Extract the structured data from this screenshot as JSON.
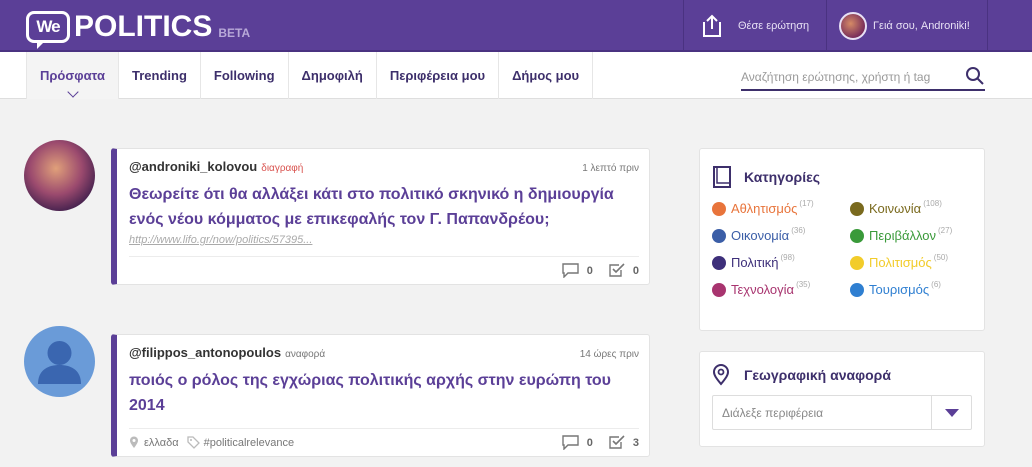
{
  "header": {
    "logo_we": "We",
    "logo_text": "POLITICS",
    "logo_beta": "BETA",
    "ask_label": "Θέσε ερώτηση",
    "greeting": "Γειά σου, Androniki!"
  },
  "nav": {
    "tabs": [
      {
        "label": "Πρόσφατα"
      },
      {
        "label": "Trending"
      },
      {
        "label": "Following"
      },
      {
        "label": "Δημοφιλή"
      },
      {
        "label": "Περιφέρεια μου"
      },
      {
        "label": "Δήμος μου"
      }
    ],
    "search_placeholder": "Αναζήτηση ερώτησης, χρήστη ή tag"
  },
  "posts": [
    {
      "user": "@androniki_kolovou",
      "tag": "διαγραφή",
      "tag_color": "#d9534f",
      "time": "1 λεπτό πριν",
      "title": "Θεωρείτε ότι θα αλλάξει κάτι στο πολιτικό σκηνικό η δημιουργία ενός νέου κόμματος με επικεφαλής τον Γ. Παπανδρέου;",
      "link": "http://www.lifo.gr/now/politics/57395...",
      "comments": "0",
      "votes": "0"
    },
    {
      "user": "@filippos_antonopoulos",
      "tag": "αναφορά",
      "tag_color": "#777777",
      "time": "14 ώρες πριν",
      "title": "ποιός ο ρόλος της εγχώριας πολιτικής αρχής στην ευρώπη του 2014",
      "location": "ελλαδα",
      "hashtag": "#politicalrelevance",
      "comments": "0",
      "votes": "3"
    }
  ],
  "categories": {
    "title": "Κατηγορίες",
    "items": [
      {
        "label": "Αθλητισμός",
        "count": "(17)",
        "color": "#e8743b"
      },
      {
        "label": "Κοινωνία",
        "count": "(108)",
        "color": "#7a6a1e"
      },
      {
        "label": "Οικονομία",
        "count": "(36)",
        "color": "#3b5ea7"
      },
      {
        "label": "Περιβάλλον",
        "count": "(27)",
        "color": "#3a9a3a"
      },
      {
        "label": "Πολιτική",
        "count": "(98)",
        "color": "#3d2f7a"
      },
      {
        "label": "Πολιτισμός",
        "count": "(50)",
        "color": "#f2cc2a"
      },
      {
        "label": "Τεχνολογία",
        "count": "(35)",
        "color": "#a8346f"
      },
      {
        "label": "Τουρισμός",
        "count": "(6)",
        "color": "#2f7fd1"
      }
    ]
  },
  "geo": {
    "title": "Γεωγραφική αναφορά",
    "select_value": "Διάλεξε περιφέρεια"
  },
  "colors": {
    "brand": "#5b3f97",
    "nav_text": "#3d2f6b"
  }
}
